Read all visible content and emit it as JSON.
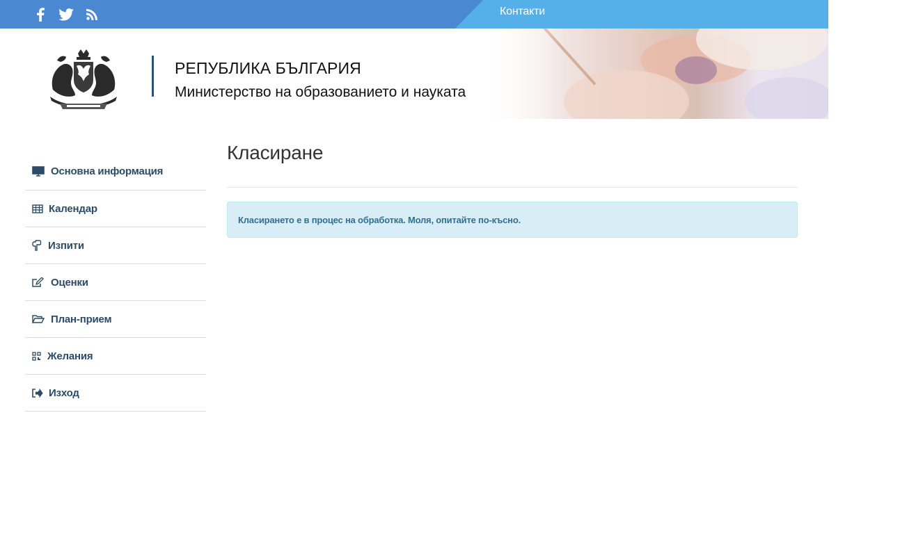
{
  "topbar": {
    "contacts_label": "Контакти",
    "social_icons": [
      "facebook-icon",
      "twitter-icon",
      "rss-icon"
    ],
    "colors": {
      "left": "#4a89d1",
      "right": "#55b0ea"
    }
  },
  "header": {
    "line1": "РЕПУБЛИКА БЪЛГАРИЯ",
    "line2": "Министерство на образованието и науката"
  },
  "sidebar": {
    "items": [
      {
        "label": "Основна информация",
        "icon": "monitor-icon"
      },
      {
        "label": "Календар",
        "icon": "calendar-table-icon"
      },
      {
        "label": "Изпити",
        "icon": "hand-pointing-icon"
      },
      {
        "label": "Оценки",
        "icon": "edit-icon"
      },
      {
        "label": "План-прием",
        "icon": "folder-open-icon"
      },
      {
        "label": "Желания",
        "icon": "qrcode-icon"
      },
      {
        "label": "Изход",
        "icon": "sign-out-icon"
      }
    ]
  },
  "main": {
    "title": "Класиране",
    "alert_text": "Класирането е в процес на обработка. Моля, опитайте по-късно."
  }
}
